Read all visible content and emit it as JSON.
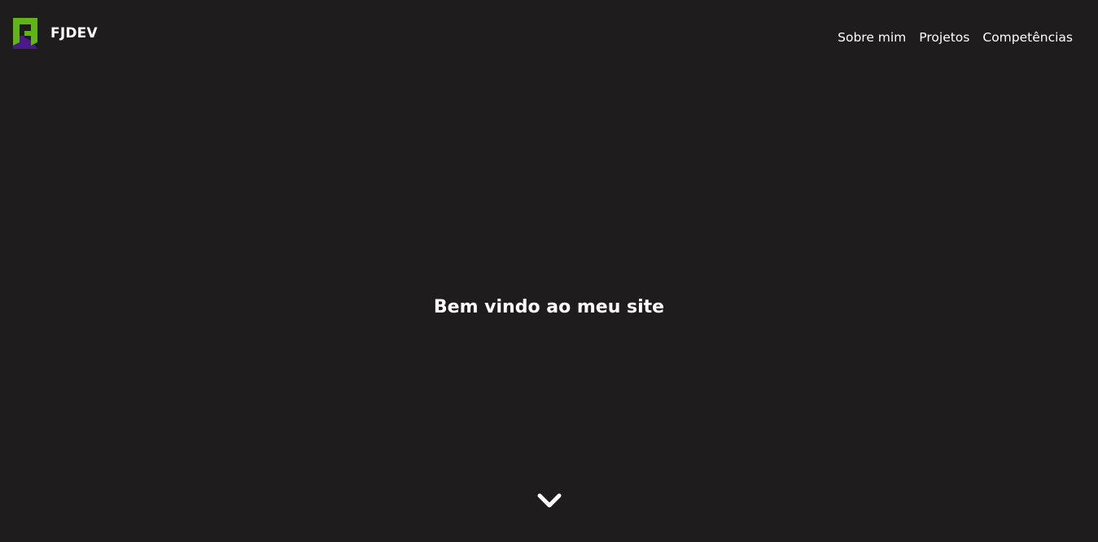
{
  "header": {
    "brand_name": "FJDEV",
    "logo_icon": "fj-logo-icon",
    "nav": [
      {
        "label": "Sobre mim"
      },
      {
        "label": "Projetos"
      },
      {
        "label": "Competências"
      }
    ]
  },
  "hero": {
    "title": "Bem vindo ao meu site",
    "scroll_icon": "chevron-down-icon"
  },
  "colors": {
    "background": "#1e1c1d",
    "text": "#ffffff",
    "logo_green": "#5fb416",
    "logo_purple": "#4a1a8c"
  }
}
